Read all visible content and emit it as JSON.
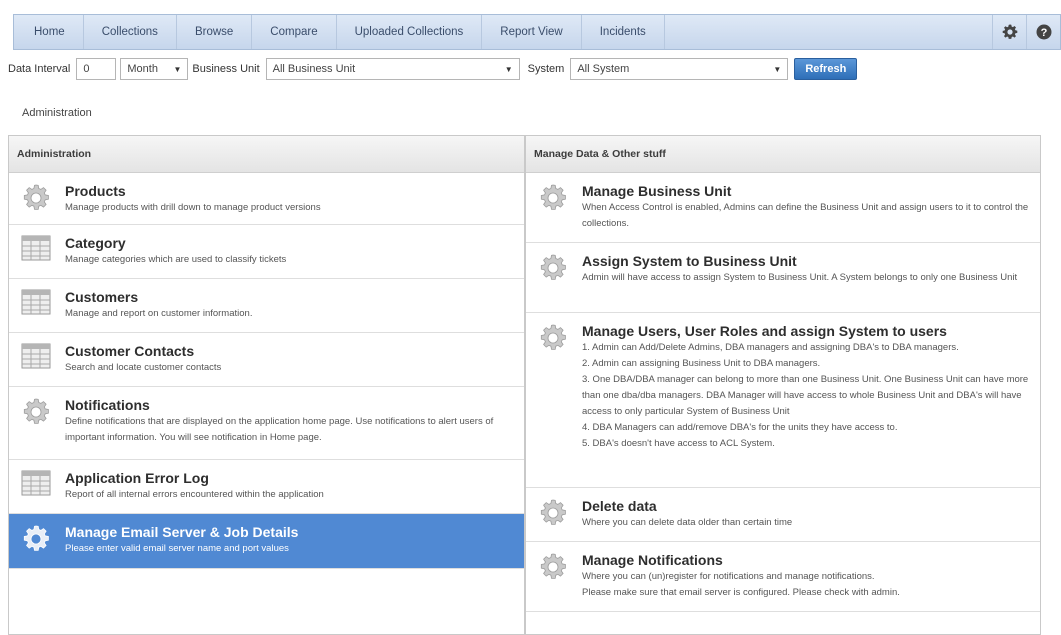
{
  "nav": {
    "items": [
      "Home",
      "Collections",
      "Browse",
      "Compare",
      "Uploaded Collections",
      "Report View",
      "Incidents"
    ],
    "icons": [
      "gear-icon",
      "help-icon"
    ]
  },
  "filters": {
    "data_interval_label": "Data Interval",
    "data_interval_value": "0",
    "period_value": "Month",
    "business_unit_label": "Business Unit",
    "business_unit_value": "All Business Unit",
    "system_label": "System",
    "system_value": "All System",
    "refresh_label": "Refresh"
  },
  "breadcrumb": "Administration",
  "left_panel": {
    "header": "Administration",
    "items": [
      {
        "title": "Products",
        "desc": "Manage products with drill down to manage product versions",
        "icon": "gear-icon"
      },
      {
        "title": "Category",
        "desc": "Manage categories which are used to classify tickets",
        "icon": "table-icon"
      },
      {
        "title": "Customers",
        "desc": "Manage and report on customer information.",
        "icon": "table-icon"
      },
      {
        "title": "Customer Contacts",
        "desc": "Search and locate customer contacts",
        "icon": "table-icon"
      },
      {
        "title": "Notifications",
        "desc": "Define notifications that are displayed on the application home page. Use notifications to alert users of important information. You will see notification in Home page.",
        "icon": "gear-icon"
      },
      {
        "title": "Application Error Log",
        "desc": "Report of all internal errors encountered within the application",
        "icon": "table-icon"
      },
      {
        "title": "Manage Email Server & Job Details",
        "desc": "Please enter valid email server name and port values",
        "icon": "gear-icon"
      }
    ]
  },
  "right_panel": {
    "header": "Manage Data & Other stuff",
    "items": [
      {
        "title": "Manage Business Unit",
        "desc": "When Access Control is enabled, Admins can define the Business Unit and assign users to it to control the collections.",
        "icon": "gear-icon"
      },
      {
        "title": "Assign System to Business Unit",
        "desc": "Admin will have access to assign System to Business Unit. A System belongs to only one Business Unit",
        "icon": "gear-icon"
      },
      {
        "title": "Manage Users, User Roles and assign System to users",
        "desc": "1. Admin can Add/Delete Admins, DBA managers and assigning DBA's to DBA managers.\n2. Admin can assigning Business Unit to DBA managers.\n3. One DBA/DBA manager can belong to more than one Business Unit. One Business Unit can have more than one dba/dba managers. DBA Manager will have access to whole Business Unit and DBA's will have access to only particular System of Business Unit\n4. DBA Managers can add/remove DBA's for the units they have access to.\n5. DBA's doesn't have access to ACL System.",
        "icon": "gear-icon"
      },
      {
        "title": "Delete data",
        "desc": "Where you can delete data older than certain time",
        "icon": "gear-icon"
      },
      {
        "title": "Manage Notifications",
        "desc": "Where you can (un)register for notifications and manage notifications.\nPlease make sure that email server is configured. Please check with admin.",
        "icon": "gear-icon"
      }
    ]
  },
  "colors": {
    "active_item": "#5089d3",
    "refresh_button": "#2e6fb8"
  }
}
